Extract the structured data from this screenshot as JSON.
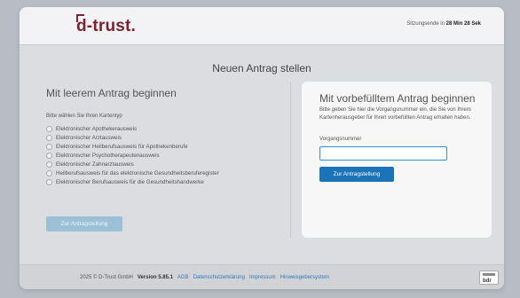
{
  "header": {
    "logo": "d-trust.",
    "session_text": "Sitzungsende in",
    "session_time": "28 Min 28 Sek"
  },
  "page_title": "Neuen Antrag stellen",
  "left": {
    "title": "Mit leerem Antrag beginnen",
    "hint": "Bitte wählen Sie Ihren Kartentyp",
    "options": [
      "Elektronischer Apothekerausweis",
      "Elektronischer Arztausweis",
      "Elektronischer Heilberufsausweis für Apothekenberufe",
      "Elektronischer Psychotherapeutenausweis",
      "Elektronischer Zahnarztausweis",
      "Heilberufsausweis für das elektronische Gesundheitsberuferegister",
      "Elektronischer Berufsausweis für die Gesundheitshandwerke"
    ],
    "button": "Zur Antragstellung"
  },
  "right": {
    "title": "Mit vorbefülltem Antrag beginnen",
    "hint": "Bitte geben Sie hier die Vorgangsnummer ein, die Sie von Ihrem Kartenherausgeber für Ihren vorbefüllten Antrag erhalten haben.",
    "field_label": "Vorgangsnummer",
    "field_value": "",
    "button": "Zur Antragstellung"
  },
  "footer": {
    "copyright": "2025 © D-Trust GmbH",
    "version": "Version 5.85.1",
    "links": [
      "AGB",
      "Datenschutzerklärung",
      "Impressum",
      "Hinweisgebersystem"
    ],
    "badge_text": "bdr"
  }
}
